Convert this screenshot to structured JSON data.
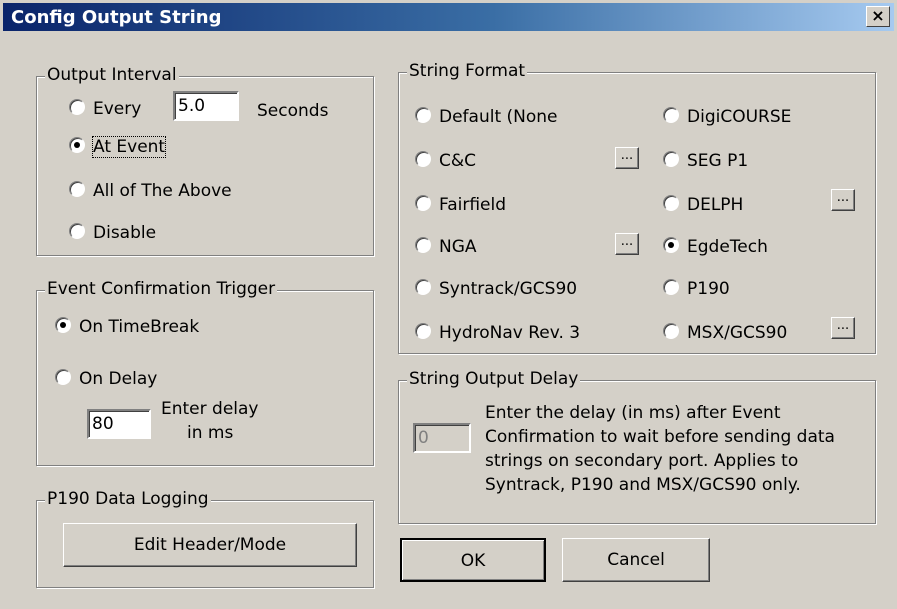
{
  "window": {
    "title": "Config Output String",
    "close": "×"
  },
  "output_interval": {
    "legend": "Output Interval",
    "every_label": "Every",
    "every_value": "5.0",
    "seconds_label": "Seconds",
    "at_event": "At Event",
    "all_above": "All of The Above",
    "disable": "Disable",
    "selected": "at_event"
  },
  "event_trigger": {
    "legend": "Event Confirmation Trigger",
    "on_timebreak": "On TimeBreak",
    "on_delay": "On Delay",
    "delay_value": "80",
    "delay_label_1": "Enter delay",
    "delay_label_2": "in ms",
    "selected": "on_timebreak"
  },
  "p190": {
    "legend": "P190 Data Logging",
    "edit_button": "Edit Header/Mode"
  },
  "string_format": {
    "legend": "String Format",
    "options_left": [
      "Default (None",
      "C&C",
      "Fairfield",
      "NGA",
      "Syntrack/GCS90",
      "HydroNav Rev. 3"
    ],
    "options_right": [
      "DigiCOURSE",
      "SEG P1",
      "DELPH",
      "EgdeTech",
      "P190",
      "MSX/GCS90"
    ],
    "selected": "EgdeTech",
    "ellipsis": "..."
  },
  "string_delay": {
    "legend": "String Output Delay",
    "value": "0",
    "description_lines": [
      "Enter the delay (in ms) after Event",
      "Confirmation to wait before sending data",
      "strings on secondary port. Applies to",
      "Syntrack, P190 and MSX/GCS90 only."
    ]
  },
  "buttons": {
    "ok": "OK",
    "cancel": "Cancel"
  }
}
